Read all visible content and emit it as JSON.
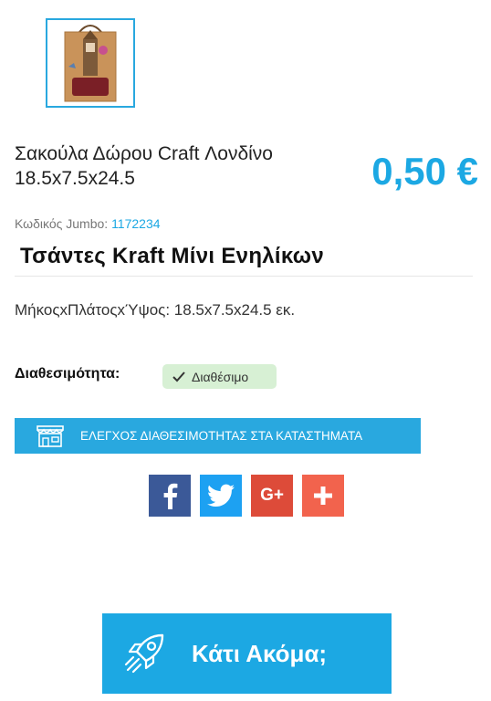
{
  "product": {
    "image_icon": "kraft-bag-london-image",
    "name": "Σακούλα Δώρου Craft Λονδίνο 18.5x7.5x24.5",
    "price": "0,50 €",
    "code_label": "Κωδικός Jumbo:",
    "code_value": "1172234",
    "category": "Τσάντες Kraft Μίνι Ενηλίκων",
    "dimensions": "ΜήκοςxΠλάτοςxΎψος: 18.5x7.5x24.5 εκ."
  },
  "availability": {
    "label": "Διαθεσιμότητα:",
    "status": "Διαθέσιμο",
    "status_color": "#d7f0d4",
    "icon": "check-icon"
  },
  "store_check": {
    "label": "ΕΛΕΓΧΟΣ ΔΙΑΘΕΣΙΜΟΤΗΤΑΣ ΣΤΑ ΚΑΤΑΣΤΗΜΑΤΑ",
    "icon": "storefront-icon",
    "color": "#29a8df"
  },
  "share": [
    {
      "icon": "facebook-icon",
      "color": "#3b5998"
    },
    {
      "icon": "twitter-icon",
      "color": "#1da1f2"
    },
    {
      "icon": "google-plus-icon",
      "color": "#dd4b39",
      "text": "G+"
    },
    {
      "icon": "plus-icon",
      "color": "#f2634d"
    }
  ],
  "more": {
    "label": "Κάτι Ακόμα;",
    "icon": "rocket-icon",
    "color": "#1ca8e3"
  },
  "accent_color": "#1ca8e3"
}
